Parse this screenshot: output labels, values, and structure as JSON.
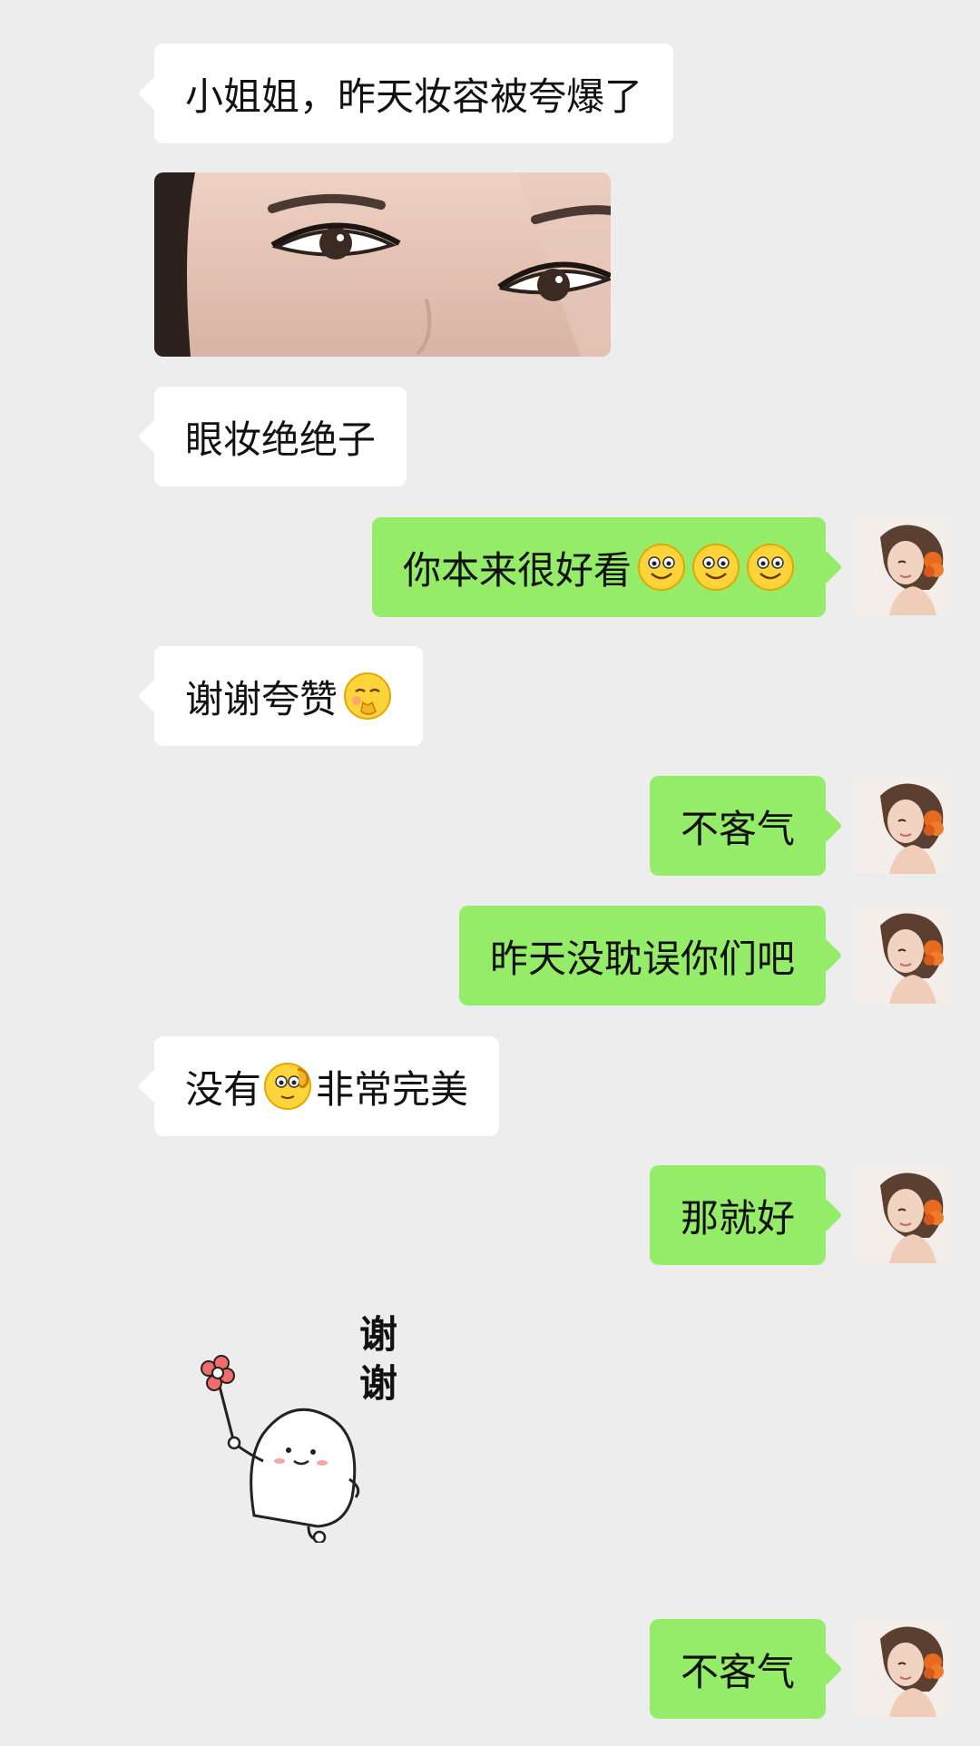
{
  "messages": [
    {
      "side": "in",
      "text": "小姐姐，昨天妆容被夸爆了"
    },
    {
      "side": "in",
      "type": "image"
    },
    {
      "side": "in",
      "text": "眼妆绝绝子"
    },
    {
      "side": "out",
      "text": "你本来很好看",
      "emojis": [
        "smile-emoji",
        "smile-emoji",
        "smile-emoji"
      ]
    },
    {
      "side": "in",
      "text": "谢谢夸赞",
      "emojis": [
        "shy-emoji"
      ]
    },
    {
      "side": "out",
      "text": "不客气"
    },
    {
      "side": "out",
      "text": "昨天没耽误你们吧"
    },
    {
      "side": "in",
      "text_before": "没有",
      "emoji": "ok-emoji",
      "text_after": "非常完美"
    },
    {
      "side": "out",
      "text": "那就好"
    },
    {
      "side": "in",
      "type": "sticker",
      "sticker_text": "谢谢"
    },
    {
      "side": "out",
      "text": "不客气"
    }
  ],
  "colors": {
    "background": "#ededed",
    "incoming_bubble": "#ffffff",
    "outgoing_bubble": "#95ec69"
  }
}
